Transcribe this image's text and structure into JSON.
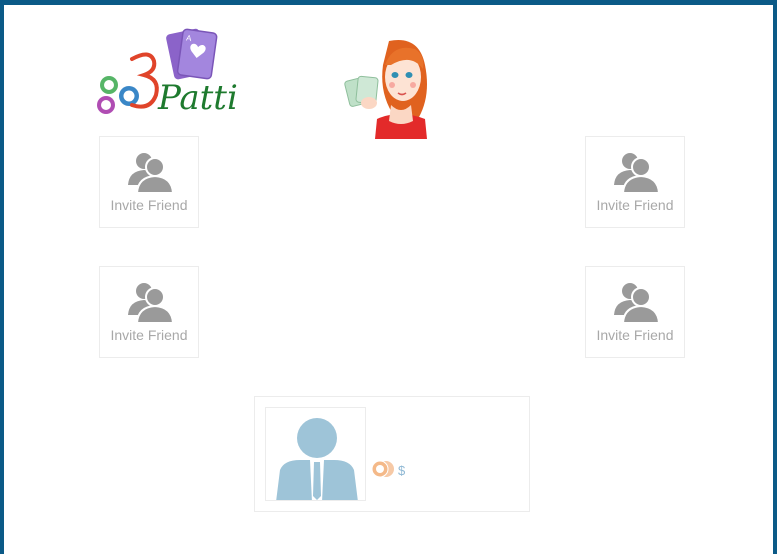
{
  "game": {
    "logo_text": "3Patti"
  },
  "seats": [
    {
      "id": "top-left",
      "label": "Invite Friend"
    },
    {
      "id": "top-right",
      "label": "Invite Friend"
    },
    {
      "id": "bottom-left",
      "label": "Invite Friend"
    },
    {
      "id": "bottom-right",
      "label": "Invite Friend"
    }
  ],
  "player": {
    "balance": "$"
  },
  "icons": {
    "seat_icon": "invite-friend-icon",
    "avatar_icon": "user-avatar-icon",
    "chips_icon": "chips-icon"
  },
  "colors": {
    "frame": "#0b5a87",
    "invite_text": "#a8a8a8",
    "avatar": "#9ec4d8",
    "logo_green": "#1e7a2e",
    "logo_red": "#e0442a",
    "card_purple": "#8b63c9"
  }
}
